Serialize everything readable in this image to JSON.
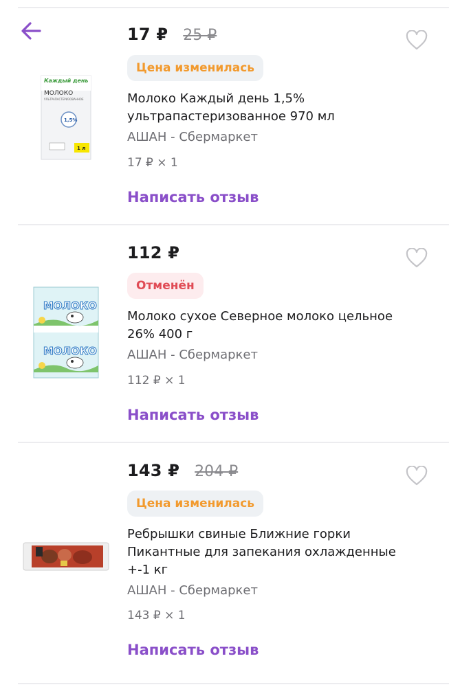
{
  "colors": {
    "accent": "#8a4fc9",
    "warning": "#f29a2e",
    "cancelled": "#e04b55"
  },
  "nav": {
    "back_icon": "arrow-left-icon"
  },
  "items": [
    {
      "price": "17 ₽",
      "old_price": "25 ₽",
      "status": "Цена изменилась",
      "status_type": "warning",
      "title": "Молоко Каждый день 1,5% ультрапастеризованное 970 мл",
      "store": "АШАН - Сбермаркет",
      "qty": "17 ₽ × 1",
      "review": "Написать отзыв",
      "image_text": {
        "brand": "Каждый день",
        "name": "МОЛОКО",
        "sub": "УЛЬТРАПАСТЕРИЗОВАННОЕ",
        "fat": "1,5%",
        "volume": "1 л"
      },
      "icon": "heart-outline-icon"
    },
    {
      "price": "112 ₽",
      "old_price": "",
      "status": "Отменён",
      "status_type": "cancelled",
      "title": "Молоко сухое Северное молоко цельное 26% 400 г",
      "store": "АШАН - Сбермаркет",
      "qty": "112 ₽ × 1",
      "review": "Написать отзыв",
      "image_text": {
        "name": "МОЛОКО"
      },
      "icon": "heart-outline-icon"
    },
    {
      "price": "143 ₽",
      "old_price": "204 ₽",
      "status": "Цена изменилась",
      "status_type": "warning",
      "title": "Ребрышки свиные Ближние горки Пикантные для запекания охлажденные +-1 кг",
      "store": "АШАН - Сбермаркет",
      "qty": "143 ₽ × 1",
      "review": "Написать отзыв",
      "icon": "heart-outline-icon"
    }
  ]
}
